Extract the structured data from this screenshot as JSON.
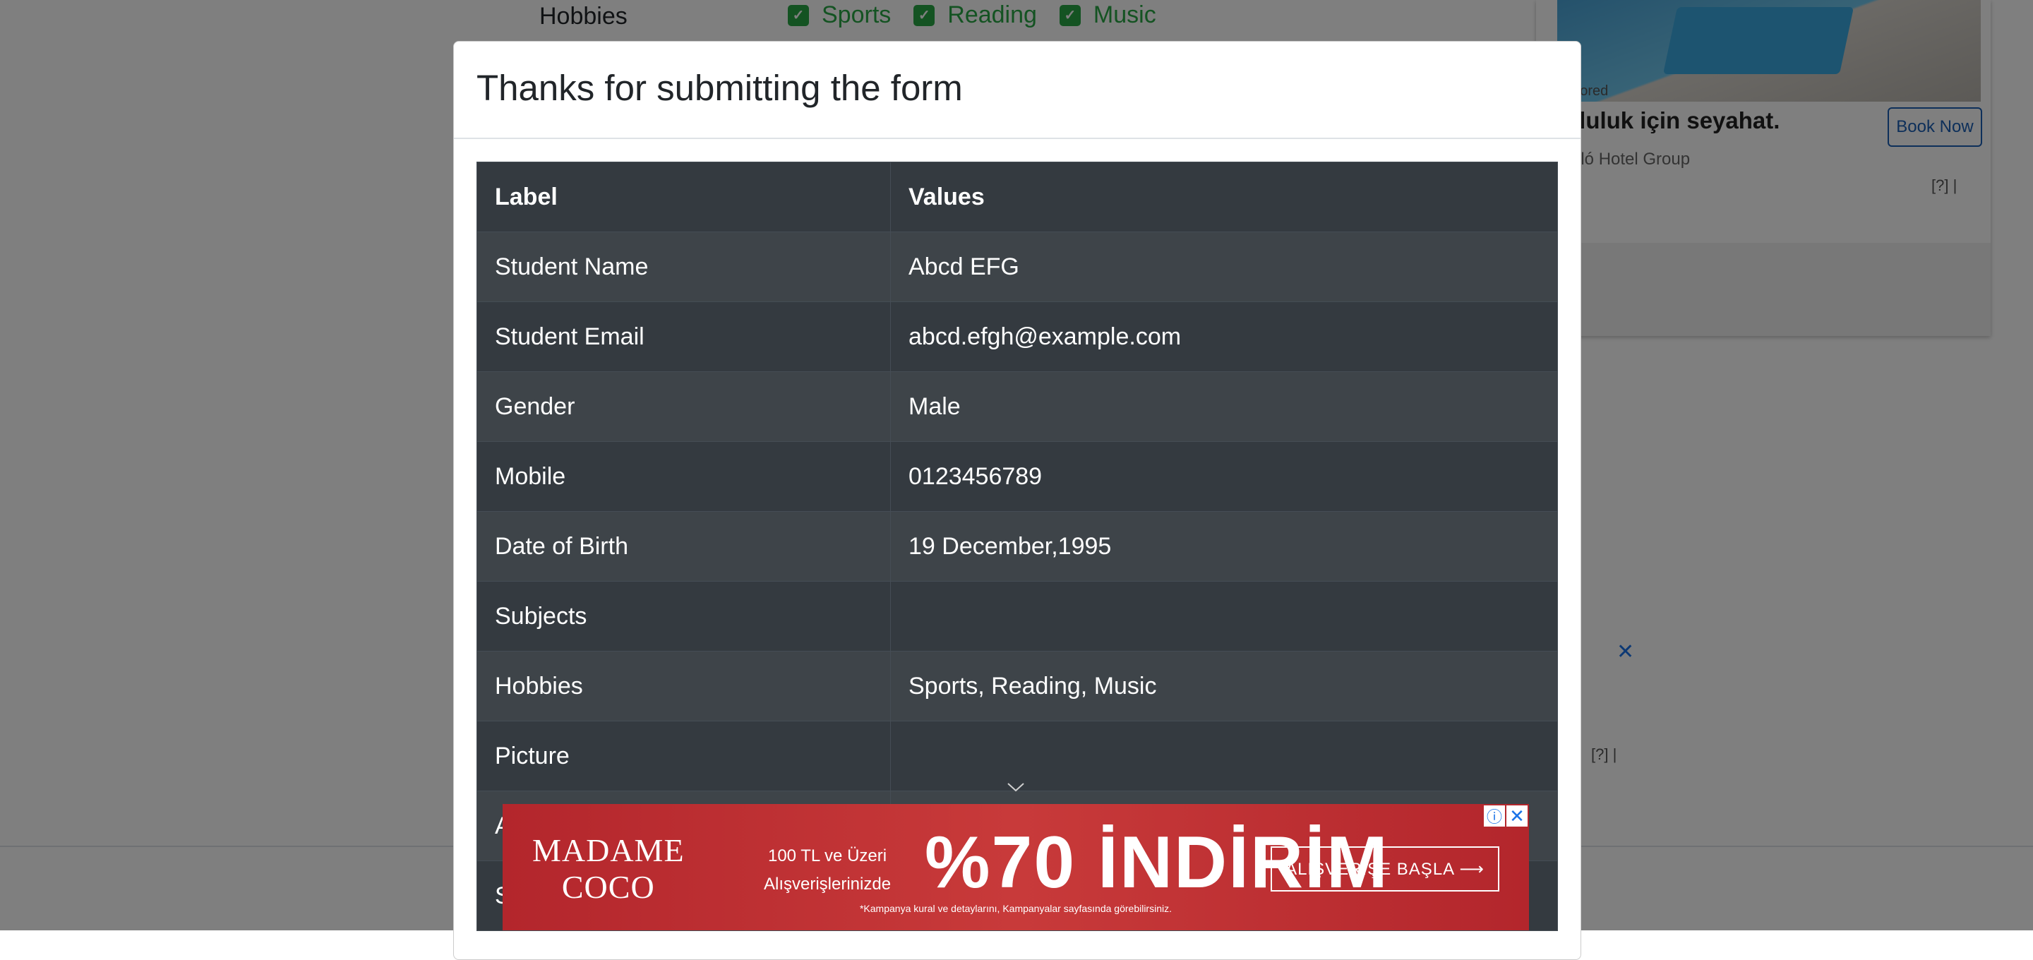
{
  "background": {
    "hobbies_label": "Hobbies",
    "hobby_options": [
      "Sports",
      "Reading",
      "Music"
    ],
    "side_ad": {
      "sponsored": "onsored",
      "headline": "utluluk için seyahat.",
      "advertiser": "rceló Hotel Group",
      "button": "Book Now",
      "adchoice": "[?] |"
    },
    "side_ad2": {
      "close": "✕",
      "adchoice": "[?] |"
    }
  },
  "modal": {
    "title": "Thanks for submitting the form",
    "table": {
      "headers": [
        "Label",
        "Values"
      ],
      "rows": [
        [
          "Student Name",
          "Abcd EFG"
        ],
        [
          "Student Email",
          "abcd.efgh@example.com"
        ],
        [
          "Gender",
          "Male"
        ],
        [
          "Mobile",
          "0123456789"
        ],
        [
          "Date of Birth",
          "19 December,1995"
        ],
        [
          "Subjects",
          ""
        ],
        [
          "Hobbies",
          "Sports, Reading, Music"
        ],
        [
          "Picture",
          ""
        ],
        [
          "A",
          ""
        ],
        [
          "S",
          ""
        ]
      ]
    }
  },
  "banner_ad": {
    "brand_line1": "MADAME",
    "brand_line2": "COCO",
    "promo_line1": "100 TL ve Üzeri",
    "promo_line2": "Alışverişlerinizde",
    "headline": "%70 İNDİRİM",
    "cta": "ALIŞVERİŞE BAŞLA ⟶",
    "fine_print": "*Kampanya kural ve detaylarını, Kampanyalar sayfasında görebilirsiniz.",
    "info": "ⓘ",
    "close": "✕"
  },
  "colors": {
    "table_bg": "#343a40",
    "accent_green": "#28a745",
    "banner_red": "#b3262c"
  }
}
